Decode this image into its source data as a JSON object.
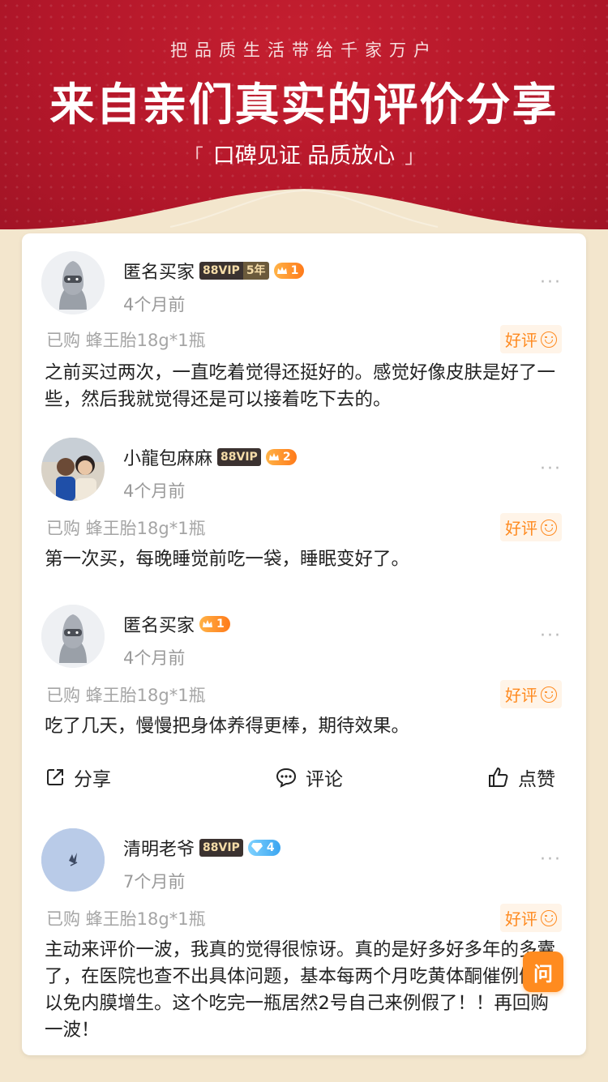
{
  "header": {
    "slogan": "把品质生活带给千家万户",
    "title": "来自亲们真实的评价分享",
    "subtitle": "口碑见证 品质放心",
    "bracket_left": "「",
    "bracket_right": "」"
  },
  "reviews": [
    {
      "name": "匿名买家",
      "vip": "88VIP",
      "vip_years": "5年",
      "level": "1",
      "time": "4个月前",
      "purchase": "已购  蜂王胎18g*1瓶",
      "rating": "好评",
      "content": "之前买过两次，一直吃着觉得还挺好的。感觉好像皮肤是好了一些，然后我就觉得还是可以接着吃下去的。"
    },
    {
      "name": "小龍包麻麻",
      "vip": "88VIP",
      "level": "2",
      "time": "4个月前",
      "purchase": "已购  蜂王胎18g*1瓶",
      "rating": "好评",
      "content": "第一次买，每晚睡觉前吃一袋，睡眠变好了。"
    },
    {
      "name": "匿名买家",
      "level": "1",
      "time": "4个月前",
      "purchase": "已购  蜂王胎18g*1瓶",
      "rating": "好评",
      "content": "吃了几天，慢慢把身体养得更棒，期待效果。"
    },
    {
      "name": "清明老爷",
      "vip": "88VIP",
      "level": "4",
      "time": "7个月前",
      "purchase": "已购  蜂王胎18g*1瓶",
      "rating": "好评",
      "content": "主动来评价一波，我真的觉得很惊讶。真的是好多好多年的多囊了，在医院也查不出具体问题，基本每两个月吃黄体酮催例假，以免内膜增生。这个吃完一瓶居然2号自己来例假了！！再回购一波！"
    }
  ],
  "actions": {
    "share": "分享",
    "comment": "评论",
    "like": "点赞"
  },
  "more": "···",
  "fab": "问",
  "colors": {
    "header_red": "#b3172a",
    "accent_orange": "#ff8a1f",
    "page_bg": "#f3e6cd"
  }
}
